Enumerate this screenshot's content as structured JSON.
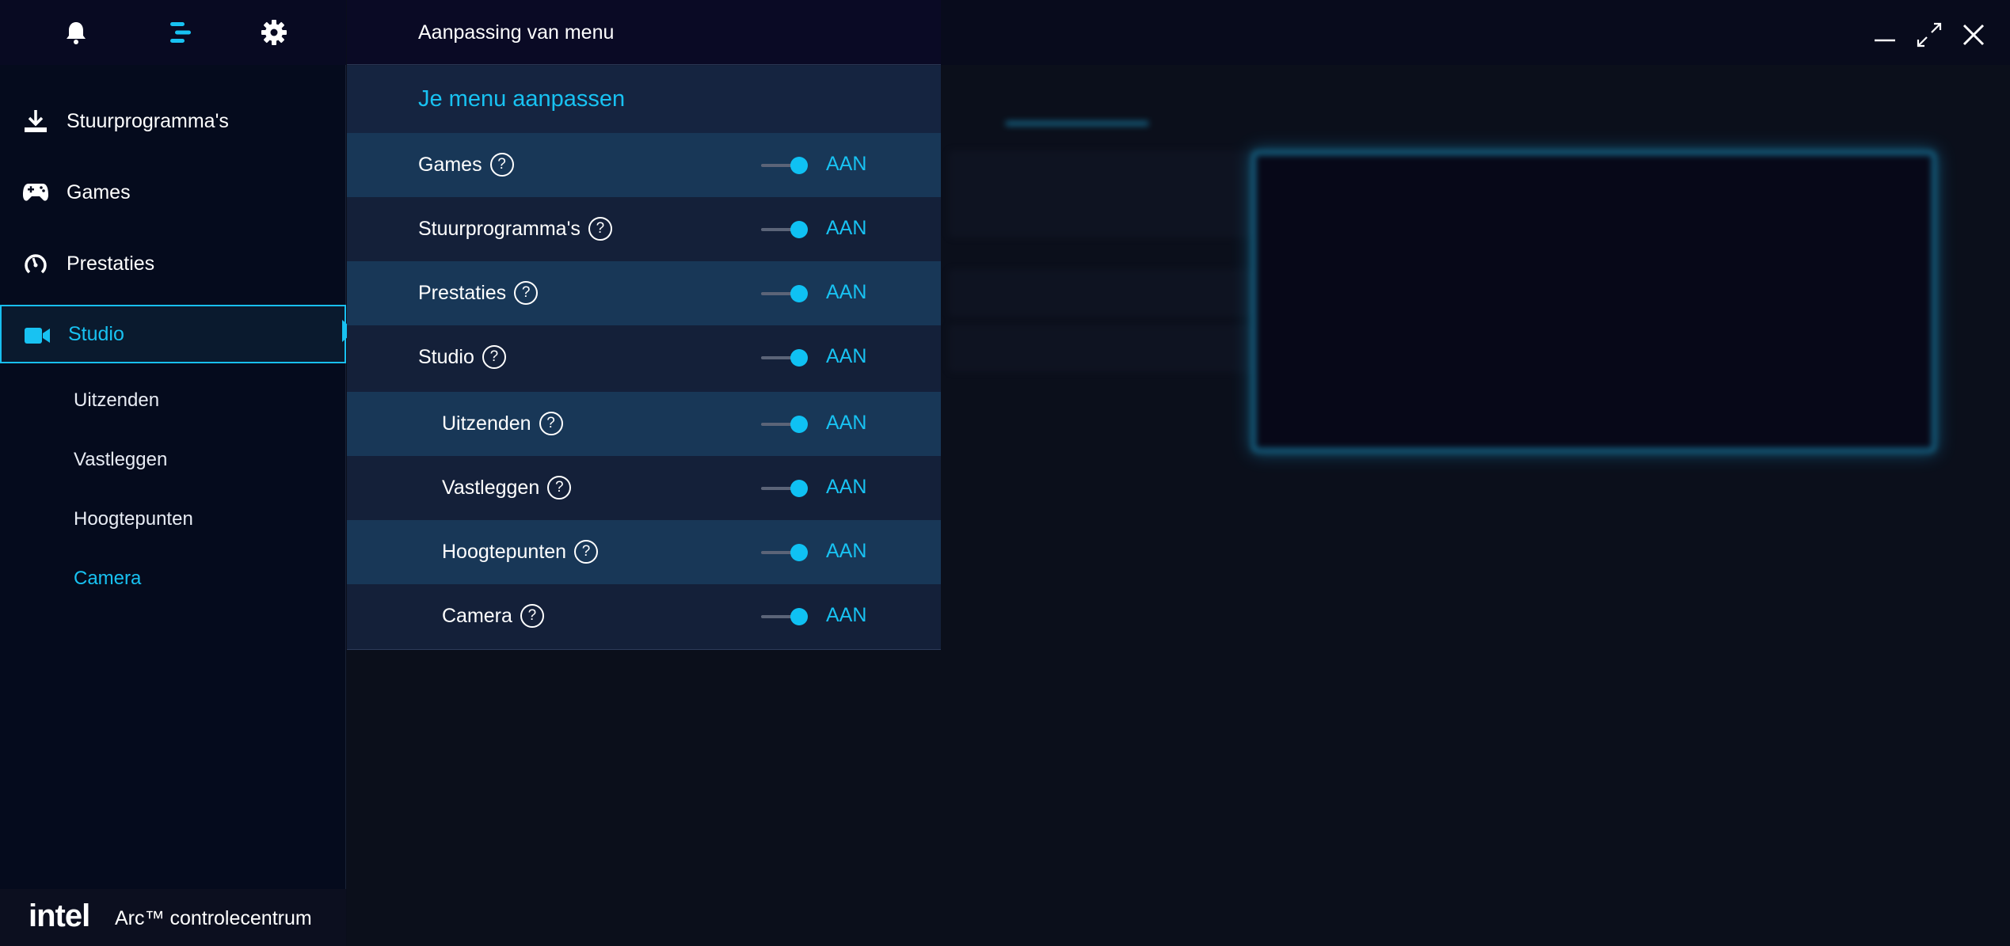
{
  "app": {
    "brand": "intel",
    "title": "Arc™ controlecentrum"
  },
  "colors": {
    "accent": "#18c2f2",
    "sidebar_bg": "#050b1d",
    "panel_bg": "#14203a",
    "row_alt_bg": "#183757"
  },
  "topbar": {
    "icons": [
      "bell-icon",
      "menu-icon",
      "gear-icon"
    ]
  },
  "sidebar": {
    "items": [
      {
        "label": "Stuurprogramma's",
        "icon": "download-icon"
      },
      {
        "label": "Games",
        "icon": "gamepad-icon"
      },
      {
        "label": "Prestaties",
        "icon": "gauge-icon"
      },
      {
        "label": "Studio",
        "icon": "video-camera-icon",
        "active": true
      }
    ],
    "subitems": [
      {
        "label": "Uitzenden"
      },
      {
        "label": "Vastleggen"
      },
      {
        "label": "Hoogtepunten"
      },
      {
        "label": "Camera",
        "active": true
      }
    ]
  },
  "menu_panel": {
    "header": "Aanpassing van menu",
    "subtitle": "Je menu aanpassen",
    "rows": [
      {
        "label": "Games",
        "state": "AAN",
        "on": true
      },
      {
        "label": "Stuurprogramma's",
        "state": "AAN",
        "on": true
      },
      {
        "label": "Prestaties",
        "state": "AAN",
        "on": true
      },
      {
        "label": "Studio",
        "state": "AAN",
        "on": true
      },
      {
        "label": "Uitzenden",
        "state": "AAN",
        "on": true
      },
      {
        "label": "Vastleggen",
        "state": "AAN",
        "on": true
      },
      {
        "label": "Hoogtepunten",
        "state": "AAN",
        "on": true
      },
      {
        "label": "Camera",
        "state": "AAN",
        "on": true
      }
    ]
  },
  "window_controls": [
    "minimize-icon",
    "maximize-icon",
    "close-icon"
  ]
}
